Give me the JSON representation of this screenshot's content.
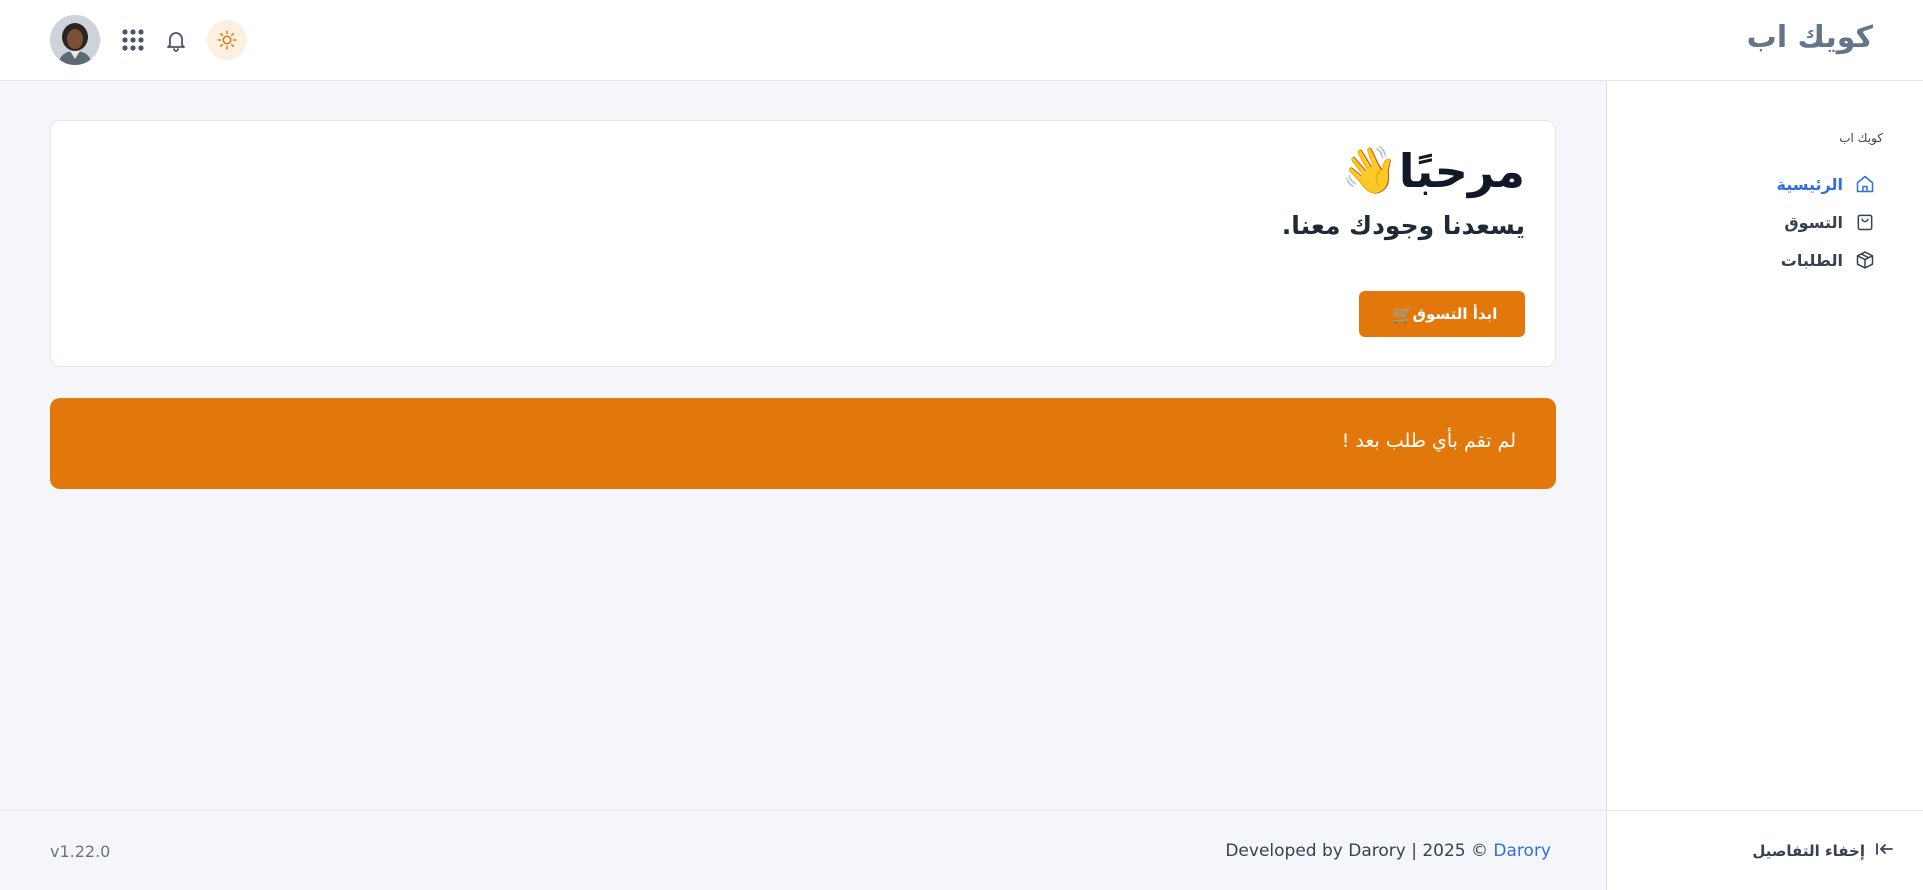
{
  "app": {
    "title": "كويك اب"
  },
  "header": {
    "avatar_icon": "user-avatar",
    "apps_icon": "grid-dots-icon",
    "notifications_icon": "bell-icon",
    "theme_icon": "sun-icon"
  },
  "sidebar": {
    "section_label": "كويك اب",
    "items": [
      {
        "label": "الرئيسية",
        "icon": "home-icon",
        "active": true
      },
      {
        "label": "التسوق",
        "icon": "shopping-bag-icon",
        "active": false
      },
      {
        "label": "الطلبات",
        "icon": "box-icon",
        "active": false
      }
    ],
    "collapse_label": "إخفاء التفاصيل",
    "collapse_icon": "collapse-arrow-icon"
  },
  "welcome": {
    "title": "مرحبًا",
    "wave_emoji": "👋",
    "subtitle": "يسعدنا وجودك معنا.",
    "shop_button_label": "ابدأ التسوق",
    "shop_button_icon": "🛒"
  },
  "alert": {
    "message": "لم تقم بأي طلب بعد !"
  },
  "footer": {
    "credit_prefix": "Developed by Darory | 2025 © ",
    "credit_link": "Darory",
    "version": "v1.22.0"
  },
  "colors": {
    "accent": "#e2780c",
    "link": "#2f6fdd",
    "background": "#f5f6fa"
  }
}
